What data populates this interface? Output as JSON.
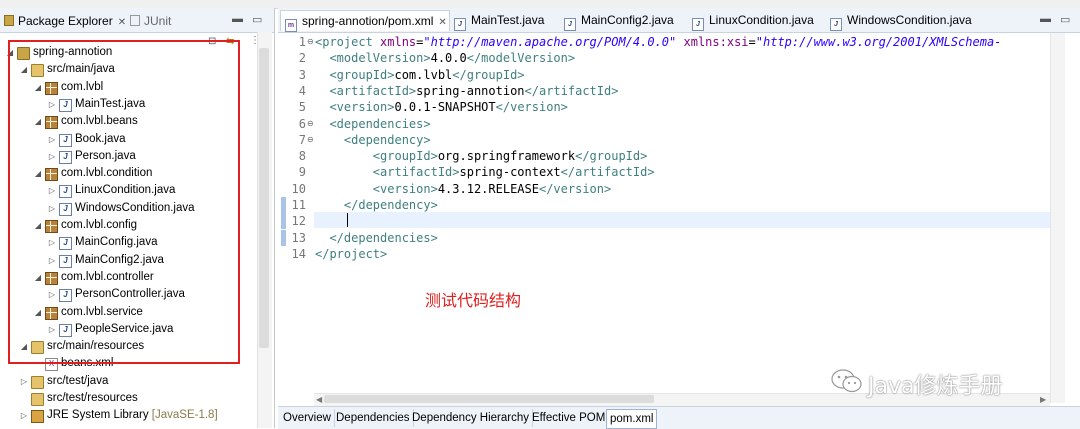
{
  "colors": {
    "annotation": "#e02020",
    "tag": "#3f7f7f",
    "string": "#2a00ff",
    "attr": "#7f007f",
    "tab_bg": "#eef3f9"
  },
  "left_panel": {
    "tabs": [
      {
        "label": "Package Explorer",
        "icon": "package-explorer-icon"
      },
      {
        "label": "JUnit",
        "icon": "junit-icon"
      }
    ],
    "tree": [
      {
        "label": "spring-annotion",
        "icon": "project",
        "level": 0,
        "twisty": "open"
      },
      {
        "label": "src/main/java",
        "icon": "srcfolder",
        "level": 1,
        "twisty": "open"
      },
      {
        "label": "com.lvbl",
        "icon": "pkg",
        "level": 2,
        "twisty": "open"
      },
      {
        "label": "MainTest.java",
        "icon": "java",
        "level": 3,
        "twisty": "closed"
      },
      {
        "label": "com.lvbl.beans",
        "icon": "pkg",
        "level": 2,
        "twisty": "open"
      },
      {
        "label": "Book.java",
        "icon": "java",
        "level": 3,
        "twisty": "closed"
      },
      {
        "label": "Person.java",
        "icon": "java",
        "level": 3,
        "twisty": "closed"
      },
      {
        "label": "com.lvbl.condition",
        "icon": "pkg",
        "level": 2,
        "twisty": "open"
      },
      {
        "label": "LinuxCondition.java",
        "icon": "java",
        "level": 3,
        "twisty": "closed"
      },
      {
        "label": "WindowsCondition.java",
        "icon": "java",
        "level": 3,
        "twisty": "closed"
      },
      {
        "label": "com.lvbl.config",
        "icon": "pkg",
        "level": 2,
        "twisty": "open"
      },
      {
        "label": "MainConfig.java",
        "icon": "java",
        "level": 3,
        "twisty": "closed"
      },
      {
        "label": "MainConfig2.java",
        "icon": "java",
        "level": 3,
        "twisty": "closed"
      },
      {
        "label": "com.lvbl.controller",
        "icon": "pkg",
        "level": 2,
        "twisty": "open"
      },
      {
        "label": "PersonController.java",
        "icon": "java",
        "level": 3,
        "twisty": "closed"
      },
      {
        "label": "com.lvbl.service",
        "icon": "pkg",
        "level": 2,
        "twisty": "open"
      },
      {
        "label": "PeopleService.java",
        "icon": "java",
        "level": 3,
        "twisty": "closed"
      },
      {
        "label": "src/main/resources",
        "icon": "srcfolder",
        "level": 1,
        "twisty": "open"
      },
      {
        "label": "beans.xml",
        "icon": "xml",
        "level": 2,
        "twisty": "none"
      },
      {
        "label": "src/test/java",
        "icon": "srcfolder",
        "level": 1,
        "twisty": "closed"
      },
      {
        "label": "src/test/resources",
        "icon": "srcfolder",
        "level": 1,
        "twisty": "none"
      },
      {
        "label": "JRE System Library",
        "suffix": "[JavaSE-1.8]",
        "icon": "lib",
        "level": 1,
        "twisty": "closed"
      }
    ]
  },
  "editor": {
    "tabs": [
      {
        "label": "spring-annotion/pom.xml",
        "active": true
      },
      {
        "label": "MainTest.java"
      },
      {
        "label": "MainConfig2.java"
      },
      {
        "label": "LinuxCondition.java"
      },
      {
        "label": "WindowsCondition.java"
      }
    ],
    "lines": [
      {
        "n": "1",
        "fold": true,
        "parts": [
          [
            "tag",
            "<project "
          ],
          [
            "attr",
            "xmlns"
          ],
          [
            "txt",
            "="
          ],
          [
            "str",
            "\"http://maven.apache.org/POM/4.0.0\""
          ],
          [
            "txt",
            " "
          ],
          [
            "attr",
            "xmlns:xsi"
          ],
          [
            "txt",
            "="
          ],
          [
            "str",
            "\"http://www.w3.org/2001/XMLSchema-"
          ]
        ]
      },
      {
        "n": "2",
        "parts": [
          [
            "txt",
            "  "
          ],
          [
            "tag",
            "<modelVersion>"
          ],
          [
            "txt",
            "4.0.0"
          ],
          [
            "tag",
            "</modelVersion>"
          ]
        ]
      },
      {
        "n": "3",
        "parts": [
          [
            "txt",
            "  "
          ],
          [
            "tag",
            "<groupId>"
          ],
          [
            "txt",
            "com.lvbl"
          ],
          [
            "tag",
            "</groupId>"
          ]
        ]
      },
      {
        "n": "4",
        "parts": [
          [
            "txt",
            "  "
          ],
          [
            "tag",
            "<artifactId>"
          ],
          [
            "txt",
            "spring-annotion"
          ],
          [
            "tag",
            "</artifactId>"
          ]
        ]
      },
      {
        "n": "5",
        "parts": [
          [
            "txt",
            "  "
          ],
          [
            "tag",
            "<version>"
          ],
          [
            "txt",
            "0.0.1-SNAPSHOT"
          ],
          [
            "tag",
            "</version>"
          ]
        ]
      },
      {
        "n": "6",
        "fold": true,
        "parts": [
          [
            "txt",
            "  "
          ],
          [
            "tag",
            "<dependencies>"
          ]
        ]
      },
      {
        "n": "7",
        "fold": true,
        "parts": [
          [
            "txt",
            "    "
          ],
          [
            "tag",
            "<dependency>"
          ]
        ]
      },
      {
        "n": "8",
        "parts": [
          [
            "txt",
            "        "
          ],
          [
            "tag",
            "<groupId>"
          ],
          [
            "txt",
            "org.springframework"
          ],
          [
            "tag",
            "</groupId>"
          ]
        ]
      },
      {
        "n": "9",
        "parts": [
          [
            "txt",
            "        "
          ],
          [
            "tag",
            "<artifactId>"
          ],
          [
            "txt",
            "spring-context"
          ],
          [
            "tag",
            "</artifactId>"
          ]
        ]
      },
      {
        "n": "10",
        "parts": [
          [
            "txt",
            "        "
          ],
          [
            "tag",
            "<version>"
          ],
          [
            "txt",
            "4.3.12.RELEASE"
          ],
          [
            "tag",
            "</version>"
          ]
        ]
      },
      {
        "n": "11",
        "marker": true,
        "parts": [
          [
            "txt",
            "    "
          ],
          [
            "tag",
            "</dependency>"
          ]
        ]
      },
      {
        "n": "12",
        "marker": true,
        "parts": []
      },
      {
        "n": "13",
        "marker": true,
        "parts": [
          [
            "txt",
            "  "
          ],
          [
            "tag",
            "</dependencies>"
          ]
        ]
      },
      {
        "n": "14",
        "parts": [
          [
            "tag",
            "</project>"
          ]
        ]
      }
    ],
    "bottom_tabs": [
      "Overview",
      "Dependencies",
      "Dependency Hierarchy",
      "Effective POM",
      "pom.xml"
    ],
    "active_bottom_tab": "pom.xml"
  },
  "annotation": "测试代码结构",
  "watermark": "Java修炼手册"
}
